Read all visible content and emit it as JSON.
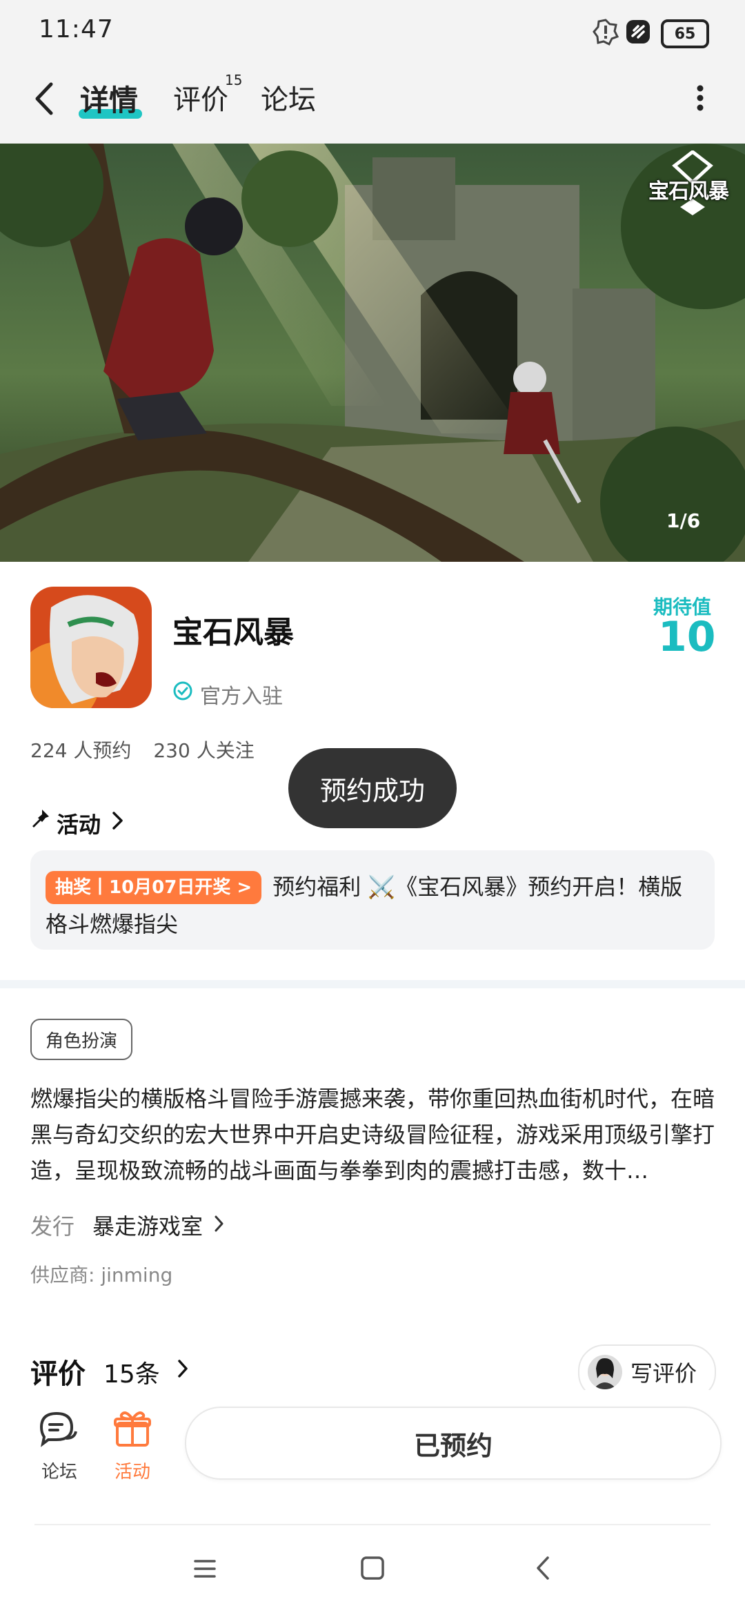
{
  "status_bar": {
    "time": "11:47",
    "battery": "65"
  },
  "nav": {
    "tabs": [
      {
        "label": "详情",
        "active": true
      },
      {
        "label": "评价",
        "badge": "15"
      },
      {
        "label": "论坛"
      }
    ]
  },
  "banner": {
    "logo_text": "宝石风暴",
    "counter": "1/6"
  },
  "game": {
    "title": "宝石风暴",
    "official_label": "官方入驻",
    "expect_label": "期待值",
    "expect_value": "10",
    "reservations": "224 人预约",
    "follows": "230 人关注"
  },
  "toast": "预约成功",
  "activity": {
    "title": "活动",
    "badge": "抽奖丨10月07日开奖 >",
    "text": "预约福利 ⚔️《宝石风暴》预约开启！横版格斗燃爆指尖"
  },
  "details": {
    "genre_tag": "角色扮演",
    "description": "燃爆指尖的横版格斗冒险手游震撼来袭，带你重回热血街机时代，在暗黑与奇幻交织的宏大世界中开启史诗级冒险征程，游戏采用顶级引擎打造，呈现极致流畅的战斗画面与拳拳到肉的震撼打击感，数十…",
    "publisher_label": "发行",
    "publisher_name": "暴走游戏室",
    "supplier": "供应商: jinming"
  },
  "reviews": {
    "title": "评价",
    "count": "15条",
    "write_label": "写评价"
  },
  "bottom_bar": {
    "forum_label": "论坛",
    "activity_label": "活动",
    "reserved_label": "已预约"
  },
  "colors": {
    "accent": "#1fc5c3",
    "orange": "#ff7a3d",
    "toast_bg": "#333333"
  }
}
